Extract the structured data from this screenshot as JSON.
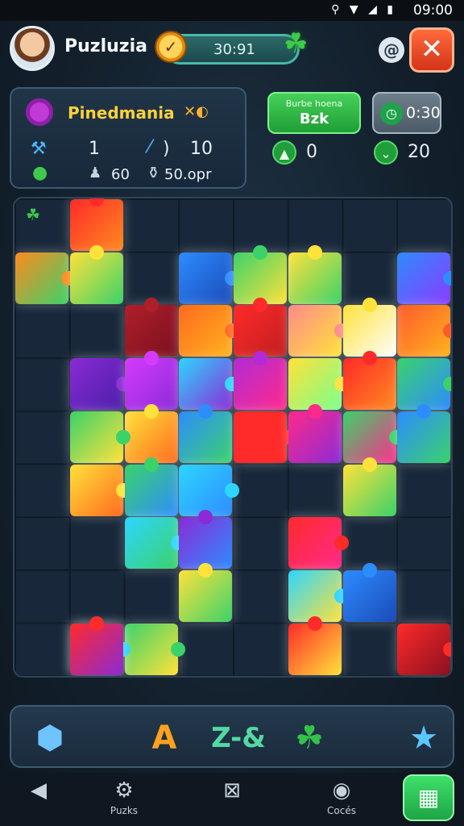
{
  "status_bar": {
    "time": "09:00",
    "icons": "⚲ ▼ ◢ ▮"
  },
  "header": {
    "app_title": "Puzluzia",
    "timer": "30:91",
    "clock_icon": "clock-icon",
    "help_label": "@",
    "close_label": "✕"
  },
  "info_panel": {
    "title": "Pinedmania",
    "title_suffix": "✕◐",
    "stat1": "1",
    "stat2_a": ") ",
    "stat2_b": "10",
    "stat3": "60",
    "stat4": "50.opr"
  },
  "action_panel": {
    "button_line1": "Burbe hoena",
    "button_line2": "Bzk",
    "timer_value": "0:30",
    "count_left": "0",
    "count_right": "20"
  },
  "tray": {
    "letter": "A",
    "combo": "Z-&"
  },
  "nav": {
    "back_label": "",
    "puzzles_label": "Puzks",
    "center_label": "",
    "codes_label": "Cocés"
  },
  "colors": {
    "accent_green": "#2fbf4a",
    "close_red": "#e0441f",
    "title_yellow": "#ffd23a"
  }
}
